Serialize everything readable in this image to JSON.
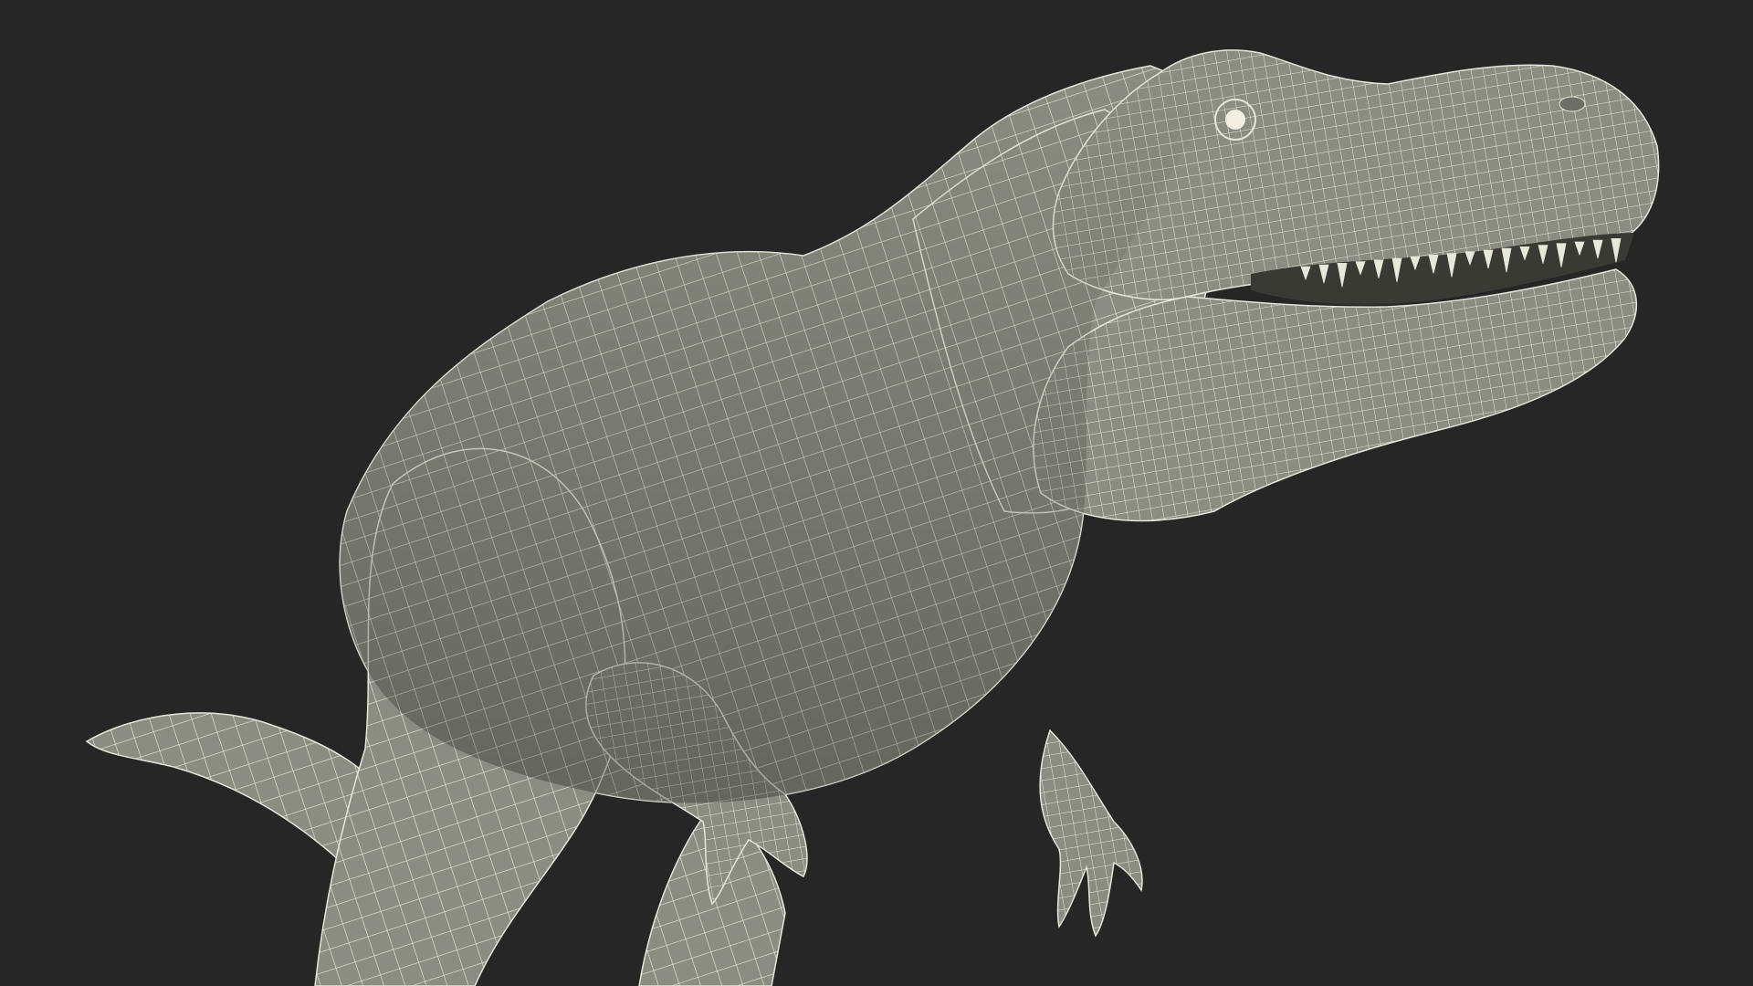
{
  "scene": {
    "subject": "trex-wireframe-model",
    "background_color": "#262626",
    "mesh_fill_color": "#8b8d82",
    "mesh_shade_color": "#6d6f66",
    "mesh_line_color": "#e6e6d8",
    "eye_color": "#f2efe0",
    "mouth_color": "#3a3a35",
    "tooth_color": "#e9e7d8"
  }
}
